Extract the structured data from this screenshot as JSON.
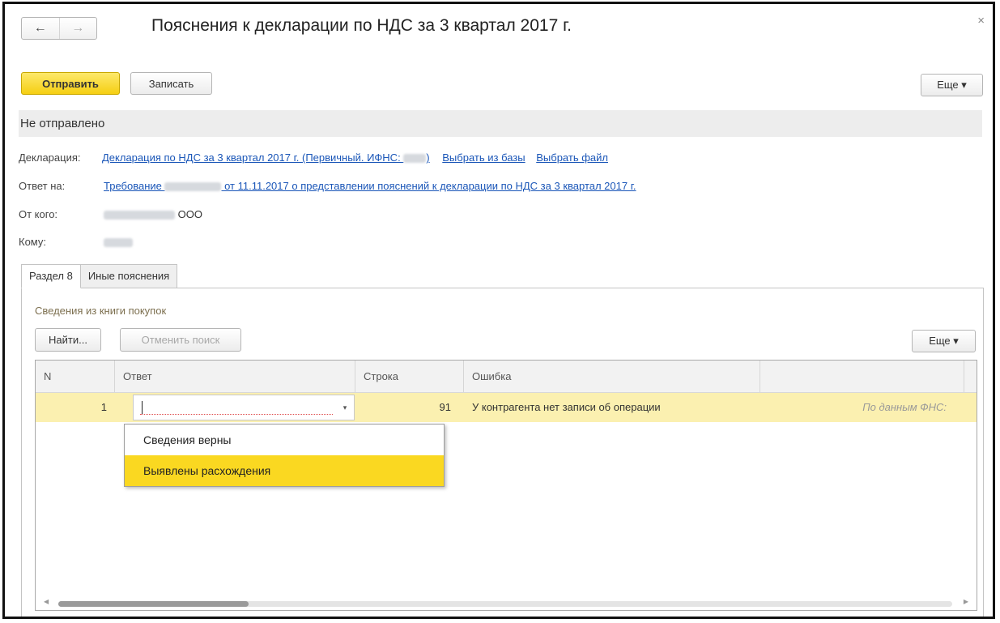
{
  "window": {
    "title": "Пояснения к декларации по НДС за 3 квартал 2017 г.",
    "back_icon": "←",
    "forward_icon": "→",
    "close_icon": "×"
  },
  "toolbar": {
    "send_label": "Отправить",
    "save_label": "Записать",
    "more_label": "Еще ▾"
  },
  "status": {
    "text": "Не отправлено"
  },
  "fields": {
    "declaration_label": "Декларация:",
    "declaration_link_part1": "Декларация по НДС за 3 квартал 2017 г. (Первичный. ИФНС: ",
    "declaration_link_part2": ")",
    "select_from_base": "Выбрать из базы",
    "select_file": "Выбрать файл",
    "reply_label": "Ответ на:",
    "reply_link_part1": "Требование ",
    "reply_link_part2": " от 11.11.2017 о представлении пояснений к декларации по НДС за 3 квартал 2017 г.",
    "from_label": "От кого:",
    "from_suffix": "ООО",
    "to_label": "Кому:"
  },
  "tabs": [
    {
      "label": "Раздел 8",
      "active": true
    },
    {
      "label": "Иные пояснения",
      "active": false
    }
  ],
  "section": {
    "caption": "Сведения из книги покупок",
    "find_label": "Найти...",
    "cancel_search_label": "Отменить поиск",
    "more_label": "Еще ▾"
  },
  "table": {
    "columns": [
      "N",
      "Ответ",
      "Строка",
      "Ошибка",
      ""
    ],
    "rows": [
      {
        "n": "1",
        "answer": "",
        "line": "91",
        "error": "У контрагента нет записи об операции",
        "extra": "По данным ФНС:"
      }
    ]
  },
  "dropdown": {
    "options": [
      {
        "label": "Сведения верны",
        "selected": false
      },
      {
        "label": "Выявлены расхождения",
        "selected": true
      }
    ],
    "arrow": "▾"
  },
  "colors": {
    "accent_yellow": "#f5cf12",
    "selected_row": "#fbf0b0",
    "link": "#1a56b8"
  }
}
